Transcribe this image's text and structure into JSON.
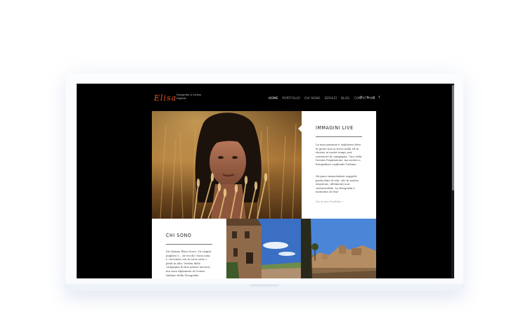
{
  "site": {
    "logo": "Elisa",
    "tagline": "Fotografia & Artista Digitale"
  },
  "nav": {
    "items": [
      {
        "label": "HOME",
        "active": true
      },
      {
        "label": "PORTFOLIO",
        "active": false
      },
      {
        "label": "CHI SONO",
        "active": false
      },
      {
        "label": "SERVIZI",
        "active": false
      },
      {
        "label": "BLOG",
        "active": false
      },
      {
        "label": "CONTATTAMI",
        "active": false
      }
    ]
  },
  "social": [
    "pinterest-icon",
    "twitter-icon",
    "googleplus-icon",
    "facebook-icon"
  ],
  "live_card": {
    "title": "IMMAGINI LIVE",
    "paragraph1": "La mia passione è esplorare dove la gente non si trova nulla ed in ritorno ai nostri tempi, per sostenere la campagna. Una volta trovata l'ispirazione, ma nostro a fotografare cogliendo l'attimo.",
    "paragraph2": "Mi piace immortalare soggetti particolari di vita, che la nostra emozione, altrimenti non catturerebbe. La fotografia è momento di vita!",
    "link": "Vai al mio Portfolio →"
  },
  "chi_card": {
    "title": "CHI SONO",
    "paragraph": "Mi chiamo Elisa Greco. Di origini pugliesi e... di vecchi! Sono nata e cresciuta con la terra sotto i piedi in alta. Vestita della campagna di mio pensie ancora), ma sono diplomata al Centro Italiano della Fotografia"
  },
  "colors": {
    "accent": "#e2572b",
    "background": "#000000",
    "card": "#ffffff"
  }
}
